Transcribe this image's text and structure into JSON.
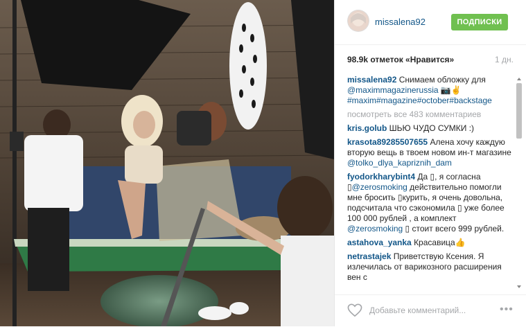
{
  "post": {
    "username": "missalena92",
    "follow_label": "ПОДПИСКИ",
    "likes": "98.9k отметок «Нравится»",
    "time": "1 дн."
  },
  "caption": {
    "user": "missalena92",
    "text": " Снимаем обложку для ",
    "link": "@maximmagazinerussia",
    "emoji": " 📷✌️",
    "tags": "#maxim#magazine#october#backstage"
  },
  "view_all": "посмотреть все 483 комментариев",
  "comments": [
    {
      "user": "kris.golub",
      "text": " ШЬЮ ЧУДО СУМКИ :)"
    },
    {
      "user": "krasota89285507655",
      "text": " Алена хочу каждую вторую вещь в твоем новом ин-т магазине ",
      "link": "@tolko_dlya_kapriznih_dam"
    },
    {
      "user": "fyodorkharybint4",
      "text": " Да ▯, я согласна ▯",
      "link": "@zerosmoking",
      "text2": " действительно помогли мне бросить ▯курить, я очень довольна, подсчитала что сэкономила ▯ уже более 100 000 рублей , а комплект ",
      "link2": "@zerosmoking",
      "text3": " ▯ стоит всего 999 рублей."
    },
    {
      "user": "astahova_yanka",
      "text": " Красавица👍"
    },
    {
      "user": "netrastajek",
      "text": " Приветствую Ксения. Я излечилась от варикозного расширения вен с"
    }
  ],
  "footer": {
    "placeholder": "Добавьте комментарий..."
  },
  "icons": {
    "heart": "heart-icon",
    "more": "more-options-icon"
  },
  "colors": {
    "follow": "#70c050",
    "link": "#125688",
    "muted": "#a5a7aa"
  }
}
